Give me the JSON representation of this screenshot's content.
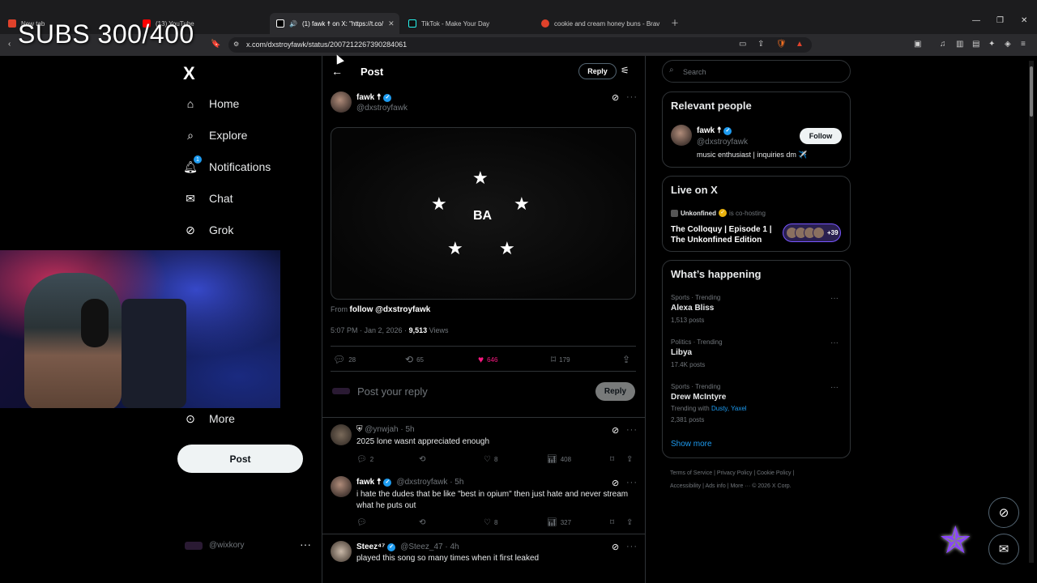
{
  "overlay": {
    "subs_counter": "SUBS 300/400"
  },
  "browser": {
    "tabs": [
      {
        "label": "New tab"
      },
      {
        "label": "(13) YouTube"
      },
      {
        "label": "(1) fawk ☨ on X: \"https://t.co/",
        "active": true
      },
      {
        "label": "TikTok - Make Your Day"
      },
      {
        "label": "cookie and cream honey buns - Brav"
      }
    ],
    "url": "x.com/dxstroyfawk/status/2007212267390284061",
    "ext_badge": "1"
  },
  "nav": {
    "logo": "X",
    "items": [
      {
        "label": "Home",
        "icon": "home-icon"
      },
      {
        "label": "Explore",
        "icon": "search-icon"
      },
      {
        "label": "Notifications",
        "icon": "bell-icon",
        "badge": "1"
      },
      {
        "label": "Chat",
        "icon": "mail-icon"
      },
      {
        "label": "Grok",
        "icon": "grok-icon"
      },
      {
        "label": "More",
        "icon": "more-circle-icon"
      }
    ],
    "post_button": "Post",
    "account_handle": "@wixkory"
  },
  "post": {
    "header_title": "Post",
    "reply_pill": "Reply",
    "author_name": "fawk ☨",
    "author_handle": "@dxstroyfawk",
    "media_text": "BA",
    "from_label": "From",
    "from_link": "follow @dxstroyfawk",
    "time": "5:07 PM · Jan 2, 2026 ·",
    "views_count": "9,513",
    "views_label": "Views",
    "stats": {
      "replies": "28",
      "reposts": "65",
      "likes": "646",
      "bookmarks": "179"
    },
    "reply_placeholder": "Post your reply",
    "reply_button": "Reply"
  },
  "replies": [
    {
      "name": "",
      "handle": "@ynwjah · 5h",
      "text": "2025 lone wasnt appreciated enough",
      "replies": "2",
      "reposts": "",
      "likes": "8",
      "views": "408"
    },
    {
      "name": "fawk ☨",
      "handle": "@dxstroyfawk · 5h",
      "text": "i hate the dudes that be like \"best in opium\" then just hate and never stream what he puts out",
      "replies": "",
      "reposts": "",
      "likes": "8",
      "views": "327"
    },
    {
      "name": "Steez⁴⁷",
      "handle": "@Steez_47 · 4h",
      "text": "played this song so many times when it first leaked"
    }
  ],
  "sidebar": {
    "search_placeholder": "Search",
    "relevant": {
      "title": "Relevant people",
      "name": "fawk ☨",
      "handle": "@dxstroyfawk",
      "follow": "Follow",
      "bio": "music enthusiast | inquiries dm ✈️"
    },
    "live": {
      "title": "Live on X",
      "host": "Unkonfined",
      "host_suffix": "is co-hosting",
      "space_title": "The Colloquy | Episode 1 | The Unkonfined Edition",
      "listeners": "+39"
    },
    "happening": {
      "title": "What’s happening",
      "trends": [
        {
          "category": "Sports · Trending",
          "name": "Alexa Bliss",
          "count": "1,513 posts"
        },
        {
          "category": "Politics · Trending",
          "name": "Libya",
          "count": "17.4K posts"
        },
        {
          "category": "Sports · Trending",
          "name": "Drew McIntyre",
          "with_label": "Trending with",
          "with_links": "Dusty, Yaxel",
          "count": "2,381 posts"
        }
      ],
      "show_more": "Show more"
    },
    "footer_line1": "Terms of Service  |  Privacy Policy  |  Cookie Policy  |",
    "footer_line2": "Accessibility  |  Ads info  |  More ···  © 2026 X Corp."
  },
  "colors": {
    "accent": "#1d9bf0",
    "like": "#f91880",
    "bg": "#000000",
    "border": "#2f3336"
  }
}
